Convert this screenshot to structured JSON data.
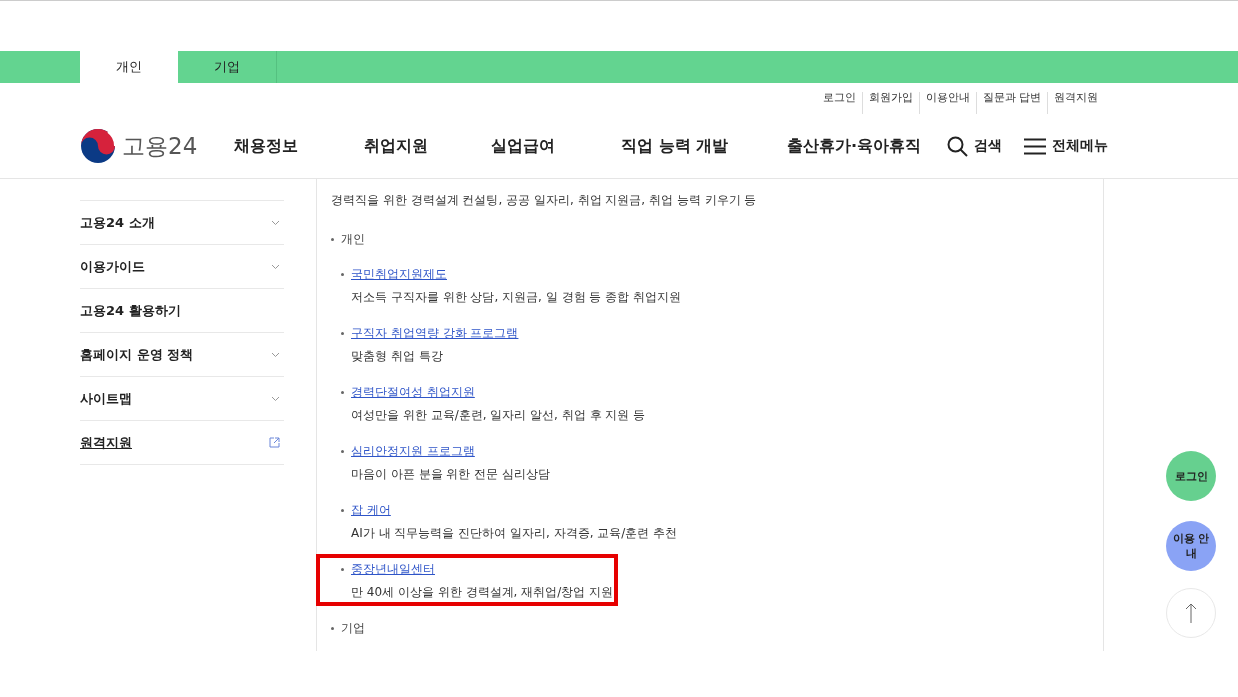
{
  "top_tabs": [
    {
      "label": "개인",
      "selected": true
    },
    {
      "label": "기업",
      "selected": false
    }
  ],
  "utility_links": [
    "로그인",
    "회원가입",
    "이용안내",
    "질문과 답변",
    "원격지원"
  ],
  "logo": {
    "text": "고용24"
  },
  "nav": [
    "채용정보",
    "취업지원",
    "실업급여",
    "직업 능력 개발",
    "출산휴가·육아휴직"
  ],
  "search": {
    "label": "검색"
  },
  "all_menu": {
    "label": "전체메뉴"
  },
  "sidebar": {
    "items": [
      {
        "label": "고용24 소개",
        "kind": "accordion"
      },
      {
        "label": "이용가이드",
        "kind": "accordion"
      },
      {
        "label": "고용24 활용하기",
        "kind": "plain"
      },
      {
        "label": "홈페이지 운영 정책",
        "kind": "accordion"
      },
      {
        "label": "사이트맵",
        "kind": "accordion"
      },
      {
        "label": "원격지원",
        "kind": "external"
      }
    ]
  },
  "content": {
    "intro": "경력직을 위한 경력설계 컨설팅, 공공 일자리, 취업 지원금, 취업 능력 키우기 등",
    "sections": [
      {
        "label": "개인",
        "items": [
          {
            "title": "국민취업지원제도",
            "description": "저소득 구직자를 위한 상담, 지원금, 일 경험 등 종합 취업지원",
            "highlighted": false
          },
          {
            "title": "구직자 취업역량 강화 프로그램",
            "description": "맞춤형 취업 특강",
            "highlighted": false
          },
          {
            "title": "경력단절여성 취업지원",
            "description": "여성만을 위한 교육/훈련, 일자리 알선, 취업 후 지원 등",
            "highlighted": false
          },
          {
            "title": "심리안정지원 프로그램",
            "description": "마음이 아픈 분을 위한 전문 심리상담",
            "highlighted": false
          },
          {
            "title": "잡 케어",
            "description": "AI가 내 직무능력을 진단하여 일자리, 자격증, 교육/훈련 추천",
            "highlighted": false
          },
          {
            "title": "중장년내일센터",
            "description": "만 40세 이상을 위한 경력설계, 재취업/창업 지원",
            "highlighted": true
          }
        ]
      },
      {
        "label": "기업"
      }
    ]
  },
  "floating_buttons": [
    {
      "label": "로그인",
      "color": "#66d08f"
    },
    {
      "label": "이용 안내",
      "color": "#8aa3f5"
    }
  ]
}
